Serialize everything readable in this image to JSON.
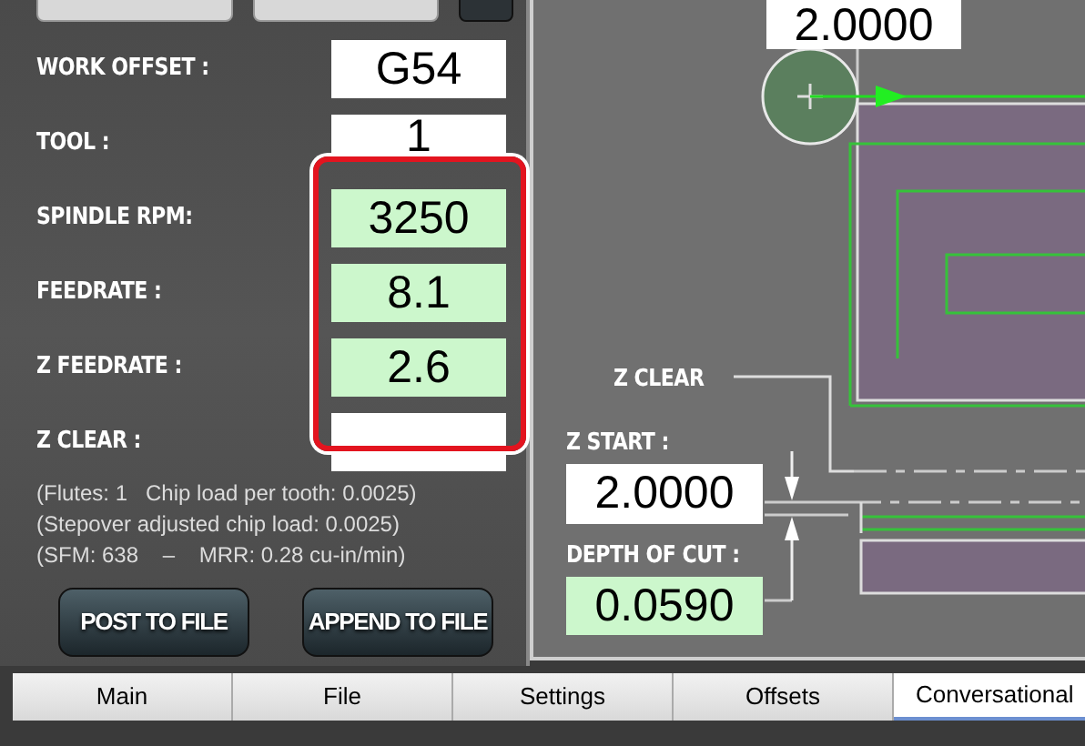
{
  "params": [
    {
      "label": "WORK OFFSET :",
      "value": "G54",
      "highlighted": false
    },
    {
      "label": "TOOL :",
      "value": "1",
      "highlighted": false
    },
    {
      "label": "SPINDLE RPM:",
      "value": "3250",
      "highlighted": true
    },
    {
      "label": "FEEDRATE :",
      "value": "8.1",
      "highlighted": true
    },
    {
      "label": "Z FEEDRATE :",
      "value": "2.6",
      "highlighted": true
    },
    {
      "label": "Z CLEAR :",
      "highlighted": false
    }
  ],
  "info": [
    "(Flutes: 1   Chip load per tooth: 0.0025)",
    "(Stepover adjusted chip load: 0.0025)",
    "(SFM: 638    –    MRR: 0.28 cu-in/min)"
  ],
  "buttons": [
    "POST TO FILE",
    "APPEND TO FILE"
  ],
  "diagram": {
    "top_value": "2.0000",
    "z_clear_label": "Z CLEAR",
    "z_start": {
      "label": "Z START :",
      "value": "2.0000",
      "highlighted": false
    },
    "depth_of_cut": {
      "label": "DEPTH OF CUT :",
      "value": "0.0590",
      "highlighted": true
    }
  },
  "tabs": [
    {
      "label": "Main",
      "selected": false
    },
    {
      "label": "File",
      "selected": false
    },
    {
      "label": "Settings",
      "selected": false
    },
    {
      "label": "Offsets",
      "selected": false
    },
    {
      "label": "Conversational",
      "selected": true
    }
  ]
}
